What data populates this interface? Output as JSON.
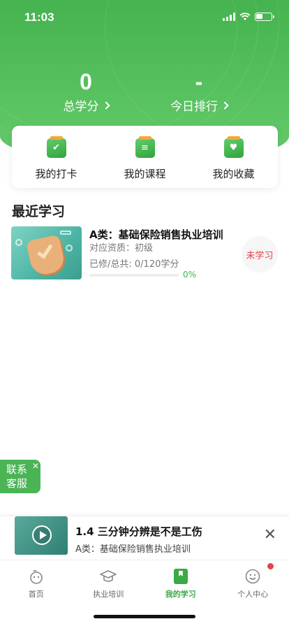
{
  "status_bar": {
    "time": "11:03"
  },
  "header": {
    "stats": [
      {
        "value": "0",
        "label": "总学分"
      },
      {
        "value": "-",
        "label": "今日排行"
      }
    ],
    "quick_actions": [
      {
        "label": "我的打卡",
        "icon": "checkin-icon",
        "glyph": "✔"
      },
      {
        "label": "我的课程",
        "icon": "course-icon",
        "glyph": "≡"
      },
      {
        "label": "我的收藏",
        "icon": "favorite-icon",
        "glyph": "♥"
      }
    ]
  },
  "recent": {
    "title": "最近学习",
    "course": {
      "title": "A类：基础保险销售执业培训",
      "qualification": "对应资质：初级",
      "credits": "已修/总共: 0/120学分",
      "progress_percent": 0,
      "progress_text": "0%",
      "status": "未学习"
    }
  },
  "service_button": {
    "line1": "联系",
    "line2": "客服",
    "close": "✕"
  },
  "mini_player": {
    "title": "1.4 三分钟分辨是不是工伤",
    "subtitle": "A类：基础保险销售执业培训",
    "close": "✕"
  },
  "tabbar": {
    "items": [
      {
        "label": "首页",
        "icon": "home-icon"
      },
      {
        "label": "执业培训",
        "icon": "graduation-cap-icon"
      },
      {
        "label": "我的学习",
        "icon": "study-book-icon",
        "active": true
      },
      {
        "label": "个人中心",
        "icon": "smiley-profile-icon",
        "badge": true
      }
    ]
  },
  "colors": {
    "brand_green": "#45b34f",
    "status_red": "#e0434b"
  }
}
